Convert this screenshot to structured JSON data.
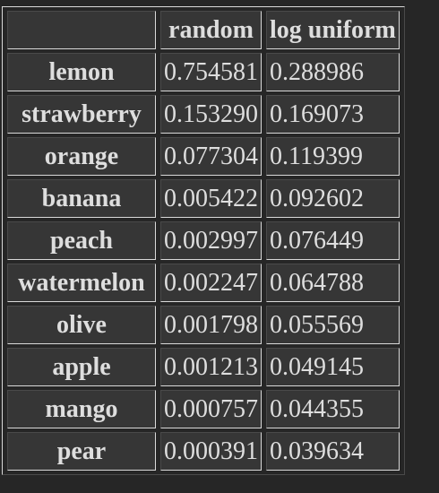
{
  "table": {
    "headers": [
      "",
      "random",
      "log uniform"
    ],
    "rows": [
      {
        "label": "lemon",
        "random": "0.754581",
        "log_uniform": "0.288986"
      },
      {
        "label": "strawberry",
        "random": "0.153290",
        "log_uniform": "0.169073"
      },
      {
        "label": "orange",
        "random": "0.077304",
        "log_uniform": "0.119399"
      },
      {
        "label": "banana",
        "random": "0.005422",
        "log_uniform": "0.092602"
      },
      {
        "label": "peach",
        "random": "0.002997",
        "log_uniform": "0.076449"
      },
      {
        "label": "watermelon",
        "random": "0.002247",
        "log_uniform": "0.064788"
      },
      {
        "label": "olive",
        "random": "0.001798",
        "log_uniform": "0.055569"
      },
      {
        "label": "apple",
        "random": "0.001213",
        "log_uniform": "0.049145"
      },
      {
        "label": "mango",
        "random": "0.000757",
        "log_uniform": "0.044355"
      },
      {
        "label": "pear",
        "random": "0.000391",
        "log_uniform": "0.039634"
      }
    ]
  },
  "colors": {
    "background": "#262626",
    "cell": "#363636",
    "text": "#dedede",
    "border_light": "#d9d9d9",
    "border_dark": "#4a4a4a"
  }
}
